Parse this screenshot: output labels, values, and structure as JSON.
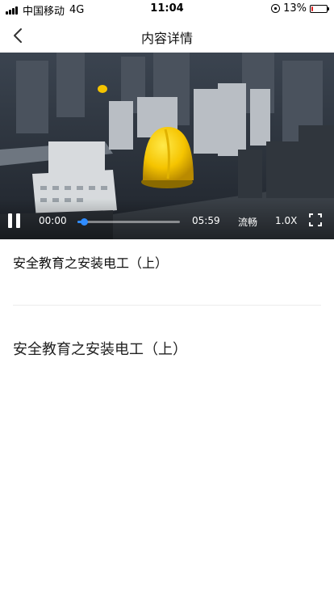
{
  "status_bar": {
    "carrier": "中国移动",
    "network": "4G",
    "time": "11:04",
    "battery_percent": "13%",
    "battery_level": 0.13,
    "battery_color": "#e02020"
  },
  "nav": {
    "back_icon": "chevron-left-icon",
    "title": "内容详情"
  },
  "video": {
    "current_time": "00:00",
    "total_time": "05:59",
    "progress": 0.06,
    "quality_label": "流畅",
    "speed_label": "1.0X",
    "accent_color": "#2f8cff"
  },
  "content": {
    "title": "安全教育之安装电工（上）",
    "body": "安全教育之安装电工（上）"
  }
}
